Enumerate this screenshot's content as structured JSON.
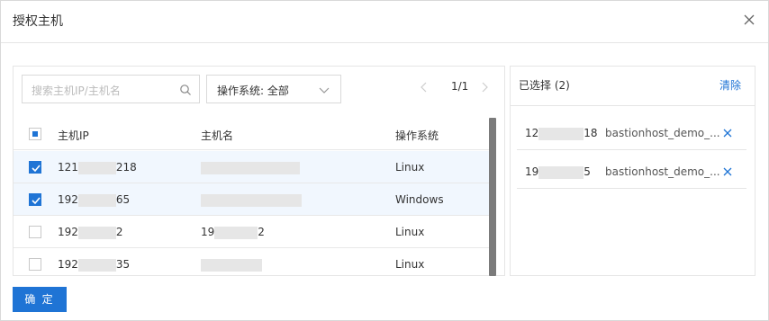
{
  "dialog": {
    "title": "授权主机",
    "confirm_label": "确 定"
  },
  "search": {
    "placeholder": "搜索主机IP/主机名"
  },
  "os_filter": {
    "value": "操作系统: 全部"
  },
  "pager": {
    "text": "1/1"
  },
  "table": {
    "headers": [
      "主机IP",
      "主机名",
      "操作系统"
    ],
    "rows": [
      {
        "ip_prefix": "121",
        "ip_suffix": "218",
        "name_prefix": "",
        "name_suffix": "",
        "os": "Linux",
        "checked": true
      },
      {
        "ip_prefix": "192",
        "ip_suffix": "65",
        "name_prefix": "",
        "name_suffix": "",
        "os": "Windows",
        "checked": true
      },
      {
        "ip_prefix": "192",
        "ip_suffix": "2",
        "name_prefix": "19",
        "name_suffix": "2",
        "os": "Linux",
        "checked": false
      },
      {
        "ip_prefix": "192",
        "ip_suffix": "35",
        "name_prefix": "",
        "name_suffix": "",
        "os": "Linux",
        "checked": false
      }
    ]
  },
  "selected": {
    "title": "已选择 (2)",
    "clear_label": "清除",
    "items": [
      {
        "ip_prefix": "12",
        "ip_suffix": "18",
        "name": "bastionhost_demo_..."
      },
      {
        "ip_prefix": "19",
        "ip_suffix": "5",
        "name": "bastionhost_demo_..."
      }
    ]
  },
  "colors": {
    "accent": "#1f74d5",
    "selected_row": "#f1f7fe"
  }
}
